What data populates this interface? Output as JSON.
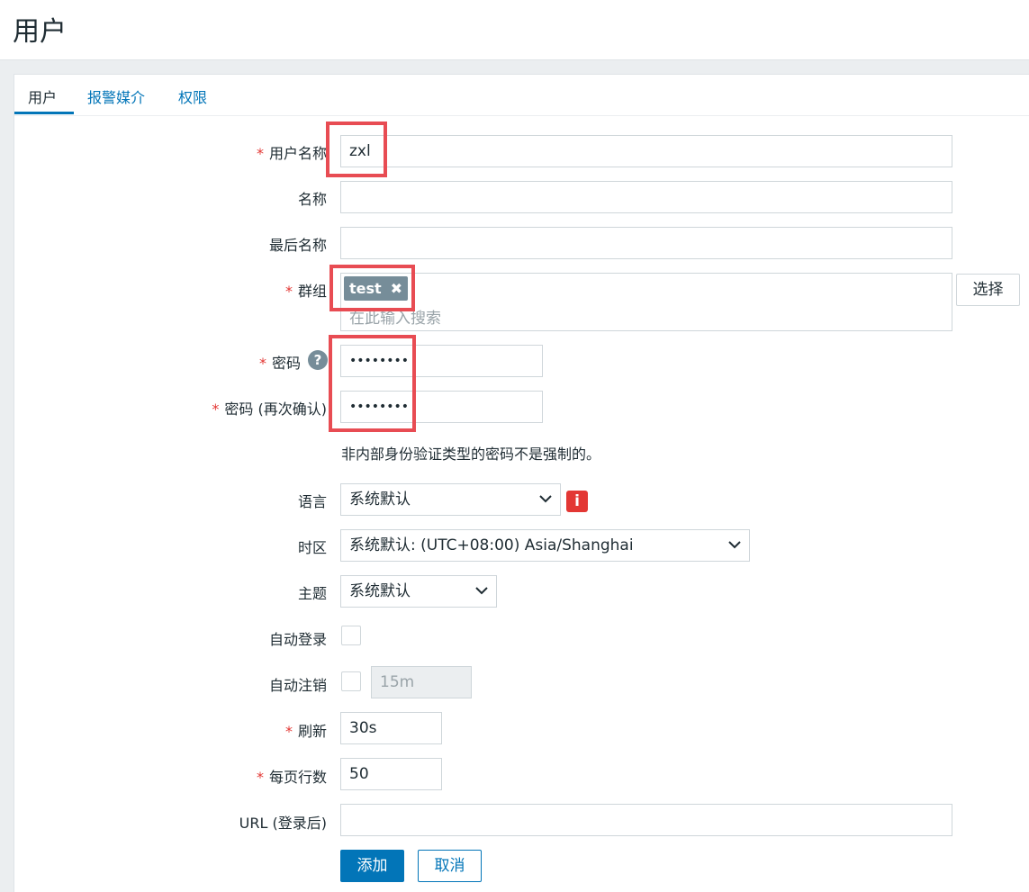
{
  "page": {
    "title": "用户"
  },
  "tabs": [
    "用户",
    "报警媒介",
    "权限"
  ],
  "form": {
    "username": {
      "label": "用户名称",
      "value": "zxl"
    },
    "name": {
      "label": "名称",
      "value": ""
    },
    "surname": {
      "label": "最后名称",
      "value": ""
    },
    "groups": {
      "label": "群组",
      "tag": "test",
      "tag_remove": "✖",
      "placeholder": "在此输入搜索",
      "select_button": "选择"
    },
    "password": {
      "label": "密码",
      "value": "••••••••",
      "help": "?"
    },
    "password_confirm": {
      "label": "密码 (再次确认)",
      "value": "••••••••"
    },
    "password_hint": "非内部身份验证类型的密码不是强制的。",
    "language": {
      "label": "语言",
      "value": "系统默认",
      "info": "i"
    },
    "timezone": {
      "label": "时区",
      "value": "系统默认: (UTC+08:00) Asia/Shanghai"
    },
    "theme": {
      "label": "主题",
      "value": "系统默认"
    },
    "autologin": {
      "label": "自动登录",
      "checked": false
    },
    "autologout": {
      "label": "自动注销",
      "checked": false,
      "value": "15m"
    },
    "refresh": {
      "label": "刷新",
      "value": "30s"
    },
    "rows_per_page": {
      "label": "每页行数",
      "value": "50"
    },
    "url": {
      "label": "URL (登录后)",
      "value": ""
    },
    "buttons": {
      "add": "添加",
      "cancel": "取消"
    }
  },
  "icons": {
    "dropdown": "chevron-down-icon"
  },
  "colors": {
    "accent": "#0275b8",
    "required": "#e33734",
    "highlight": "#e84c53"
  }
}
